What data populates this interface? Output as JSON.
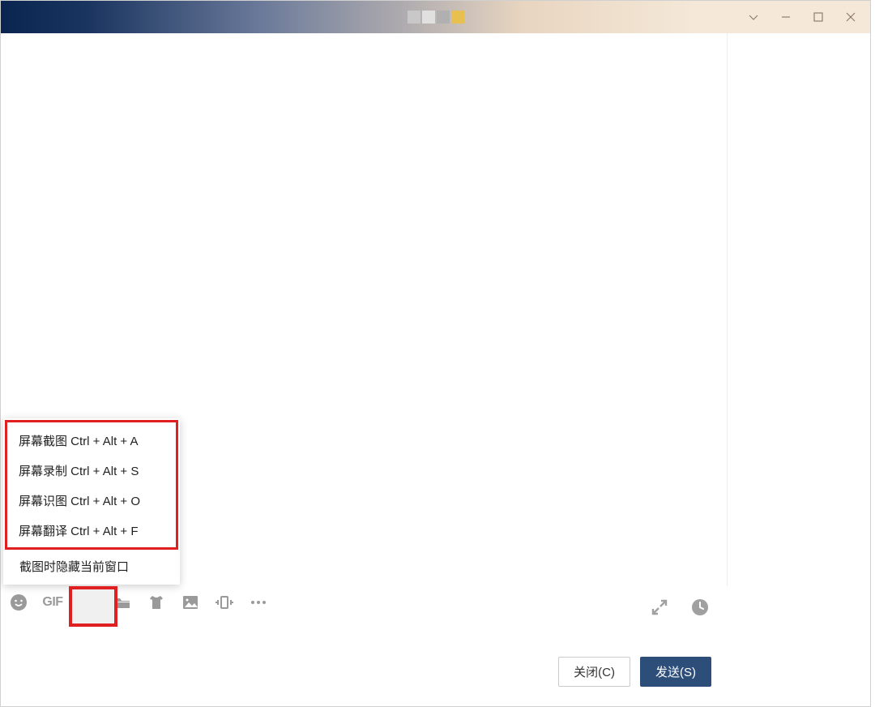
{
  "popup": {
    "items": [
      "屏幕截图 Ctrl + Alt + A",
      "屏幕录制 Ctrl + Alt + S",
      "屏幕识图 Ctrl + Alt + O",
      "屏幕翻译 Ctrl + Alt + F"
    ],
    "extra_item": "截图时隐藏当前窗口"
  },
  "toolbar": {
    "gif_label": "GIF"
  },
  "buttons": {
    "close": "关闭(C)",
    "send": "发送(S)"
  }
}
